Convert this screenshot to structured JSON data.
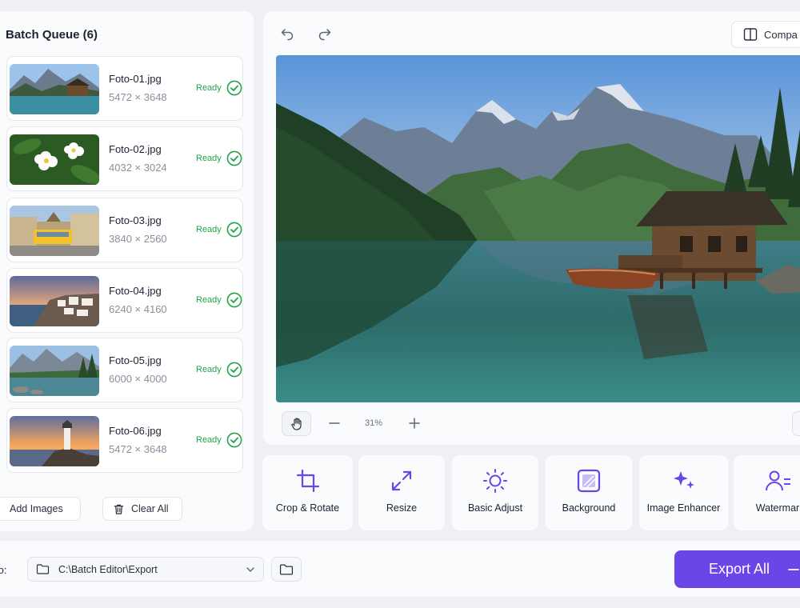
{
  "queue": {
    "title": "Batch Queue (6)",
    "items": [
      {
        "name": "Foto-01.jpg",
        "dims": "5472 × 3648",
        "status": "Ready"
      },
      {
        "name": "Foto-02.jpg",
        "dims": "4032 × 3024",
        "status": "Ready"
      },
      {
        "name": "Foto-03.jpg",
        "dims": "3840 × 2560",
        "status": "Ready"
      },
      {
        "name": "Foto-04.jpg",
        "dims": "6240 × 4160",
        "status": "Ready"
      },
      {
        "name": "Foto-05.jpg",
        "dims": "6000 × 4000",
        "status": "Ready"
      },
      {
        "name": "Foto-06.jpg",
        "dims": "5472 × 3648",
        "status": "Ready"
      }
    ],
    "add_label": "Add Images",
    "clear_label": "Clear All"
  },
  "editor": {
    "compare_label": "Compa",
    "zoom": "31%"
  },
  "tools": [
    {
      "label": "Crop & Rotate",
      "icon": "crop-icon"
    },
    {
      "label": "Resize",
      "icon": "resize-icon"
    },
    {
      "label": "Basic Adjust",
      "icon": "sun-icon"
    },
    {
      "label": "Background",
      "icon": "background-icon"
    },
    {
      "label": "Image Enhancer",
      "icon": "sparkle-icon"
    },
    {
      "label": "Watermar",
      "icon": "watermark-icon"
    }
  ],
  "export": {
    "save_to_label": "to:",
    "path": "C:\\Batch Editor\\Export",
    "button_label": "Export All"
  },
  "colors": {
    "accent": "#6a45e8",
    "ready": "#22a34a"
  }
}
